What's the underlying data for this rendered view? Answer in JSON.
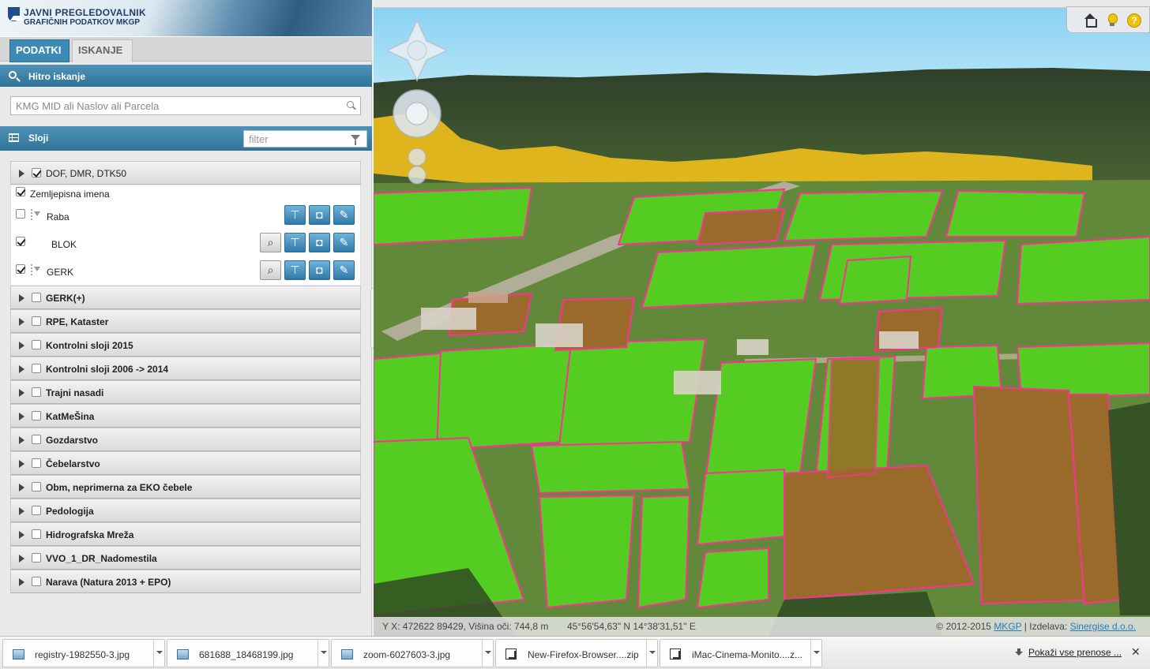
{
  "app": {
    "title_line1": "JAVNI PREGLEDOVALNIK",
    "title_line2": "GRAFIČNIH PODATKOV MKGP"
  },
  "tabs": [
    {
      "label": "PODATKI",
      "active": true
    },
    {
      "label": "ISKANJE",
      "active": false
    }
  ],
  "quick_search": {
    "title": "Hitro iskanje",
    "placeholder": "KMG MID ali Naslov ali Parcela"
  },
  "layers_panel": {
    "title": "Sloji",
    "filter_placeholder": "filter"
  },
  "expanded_group": {
    "label": "DOF, DMR, DTK50",
    "checked": true,
    "sublayers": [
      {
        "label": "Zemljepisna imena",
        "checked": true,
        "tools": []
      },
      {
        "label": "Raba",
        "checked": false,
        "tools": [
          "style",
          "3d",
          "edit"
        ]
      },
      {
        "label": "BLOK",
        "checked": true,
        "tools": [
          "zoom",
          "style",
          "3d",
          "edit"
        ]
      },
      {
        "label": "GERK",
        "checked": true,
        "tools": [
          "zoom",
          "style",
          "3d",
          "edit"
        ]
      }
    ]
  },
  "layer_groups": [
    {
      "label": "GERK(+)",
      "checked": false
    },
    {
      "label": "RPE, Kataster",
      "checked": false
    },
    {
      "label": "Kontrolni sloji 2015",
      "checked": false
    },
    {
      "label": "Kontrolni sloji 2006 -> 2014",
      "checked": false
    },
    {
      "label": "Trajni nasadi",
      "checked": false
    },
    {
      "label": "KatMeŠina",
      "checked": false
    },
    {
      "label": "Gozdarstvo",
      "checked": false
    },
    {
      "label": "Čebelarstvo",
      "checked": false
    },
    {
      "label": "Obm, neprimerna za EKO čebele",
      "checked": false
    },
    {
      "label": "Pedologija",
      "checked": false
    },
    {
      "label": "Hidrografska Mreža",
      "checked": false
    },
    {
      "label": "VVO_1_DR_Nadomestila",
      "checked": false
    },
    {
      "label": "Narava (Natura 2013 + EPO)",
      "checked": false
    }
  ],
  "map": {
    "toolbar_icons": [
      "home-icon",
      "lightbulb-icon",
      "help-icon"
    ],
    "help_glyph": "?",
    "status": {
      "coords": "Y X: 472622 89429, Višina oči: 744,8 m",
      "latlon": "45°56'54,63\" N 14°38'31,51\" E",
      "copyright": "© 2012-2015",
      "owner_link": "MKGP",
      "separator": "| Izdelava:",
      "maker_link": "Sinergise d.o.o."
    },
    "colors": {
      "gerk": "#55cc22",
      "fields_brown": "#9a6a2a",
      "blok_outline": "#ff2f9a",
      "yellow": "#f5c21a",
      "sky": "#8fd4f4"
    }
  },
  "downloads": {
    "items": [
      {
        "name": "registry-1982550-3.jpg",
        "icon": "image-file-icon"
      },
      {
        "name": "681688_18468199.jpg",
        "icon": "image-file-icon"
      },
      {
        "name": "zoom-6027603-3.jpg",
        "icon": "image-file-icon"
      },
      {
        "name": "New-Firefox-Browser....zip",
        "icon": "zip-file-icon"
      },
      {
        "name": "iMac-Cinema-Monito....z...",
        "icon": "zip-file-icon"
      }
    ],
    "show_all": "Pokaži vse prenose ...",
    "close_glyph": "✕"
  }
}
